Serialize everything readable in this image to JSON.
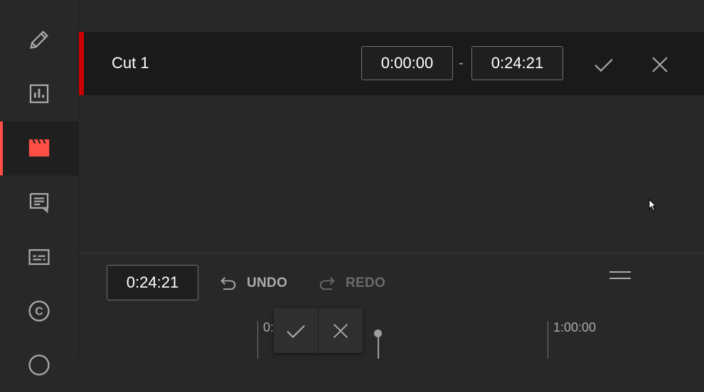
{
  "sidebar": {
    "items": [
      {
        "name": "details",
        "icon": "pencil-icon"
      },
      {
        "name": "analytics",
        "icon": "bar-chart-icon"
      },
      {
        "name": "editor",
        "icon": "clapperboard-icon",
        "active": true
      },
      {
        "name": "comments",
        "icon": "comment-icon"
      },
      {
        "name": "subtitles",
        "icon": "subtitles-icon"
      },
      {
        "name": "copyright",
        "icon": "copyright-icon",
        "glyph": "C"
      },
      {
        "name": "earn",
        "icon": "dollar-icon"
      }
    ]
  },
  "cut": {
    "label": "Cut 1",
    "start": "0:00:00",
    "separator": "-",
    "end": "0:24:21",
    "confirm_icon": "check-icon",
    "cancel_icon": "close-icon"
  },
  "timeline": {
    "current_time": "0:24:21",
    "undo_label": "UNDO",
    "redo_label": "REDO",
    "tick_labels": [
      "0:",
      "1:00:00"
    ]
  },
  "colors": {
    "accent": "#cc0000",
    "active_icon": "#ff4e45",
    "background": "#282828",
    "row_background": "#1a1a1a"
  }
}
